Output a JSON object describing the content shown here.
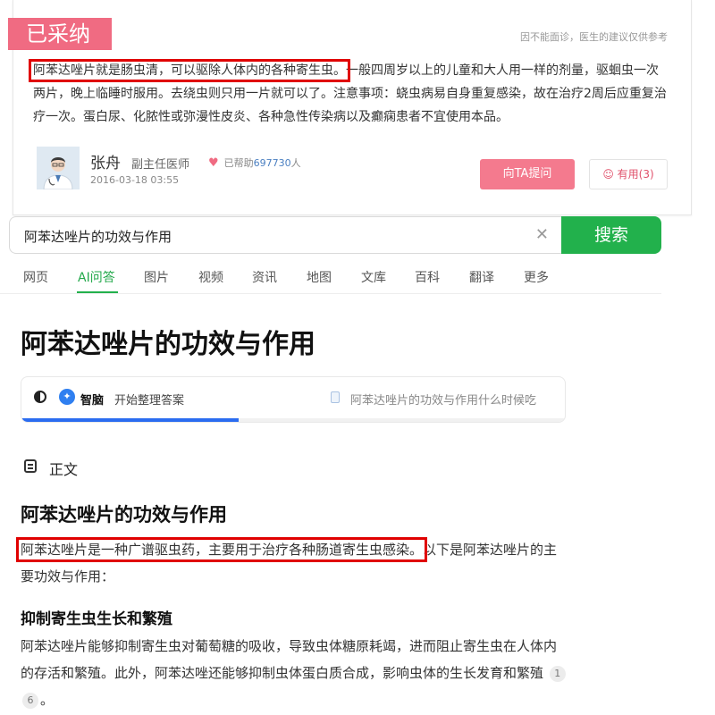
{
  "answer_card": {
    "accepted_tag": "已采纳",
    "disclaimer": "因不能面诊，医生的建议仅供参考",
    "highlighted_text": "阿苯达唑片就是肠虫清，可以驱除人体内的各种寄生虫。",
    "rest_text": "一般四周岁以上的儿童和大人用一样的剂量，驱蛔虫一次两片，晚上临睡时服用。去绕虫则只用一片就可以了。注意事项：蛲虫病易自身重复感染，故在治疗2周后应重复治疗一次。蛋白尿、化脓性或弥漫性皮炎、各种急性传染病以及癫痫患者不宜使用本品。",
    "doctor": {
      "name": "张舟",
      "title": "副主任医师",
      "helped_prefix": "已帮助",
      "helped_count": "697730",
      "helped_suffix": "人",
      "time": "2016-03-18 03:55"
    },
    "ask_button": "向TA提问",
    "useful_button": "有用(3)"
  },
  "search": {
    "query": "阿苯达唑片的功效与作用",
    "clear_icon": "close-icon",
    "button": "搜索"
  },
  "tabs": [
    {
      "label": "网页",
      "active": false
    },
    {
      "label": "AI问答",
      "active": true
    },
    {
      "label": "图片",
      "active": false
    },
    {
      "label": "视频",
      "active": false
    },
    {
      "label": "资讯",
      "active": false
    },
    {
      "label": "地图",
      "active": false
    },
    {
      "label": "文库",
      "active": false
    },
    {
      "label": "百科",
      "active": false
    },
    {
      "label": "翻译",
      "active": false
    },
    {
      "label": "更多",
      "active": false
    }
  ],
  "page_title": "阿苯达唑片的功效与作用",
  "ai_panel": {
    "brand": "智脑",
    "status": "开始整理答案",
    "related_query": "阿苯达唑片的功效与作用什么时候吃",
    "progress": 0.4
  },
  "content": {
    "section_label": "正文",
    "sub_title": "阿苯达唑片的功效与作用",
    "para1_highlight": "阿苯达唑片是一种广谱驱虫药，主要用于治疗各种肠道寄生虫感染。",
    "para1_rest": "以下是阿苯达唑片的主要功效与作用：",
    "heading2": "抑制寄生虫生长和繁殖",
    "para2": "阿苯达唑片能够抑制寄生虫对葡萄糖的吸收，导致虫体糖原耗竭，进而阻止寄生虫在人体内的存活和繁殖。此外，阿苯达唑还能够抑制虫体蛋白质合成，影响虫体的生长发育和繁殖",
    "citations": [
      "1",
      "6"
    ],
    "para2_end": "。"
  },
  "colors": {
    "accent_green": "#22b14c",
    "accepted_pink": "#f06b82",
    "highlight_red": "#e00000",
    "progress_blue": "#2b6cf0"
  }
}
